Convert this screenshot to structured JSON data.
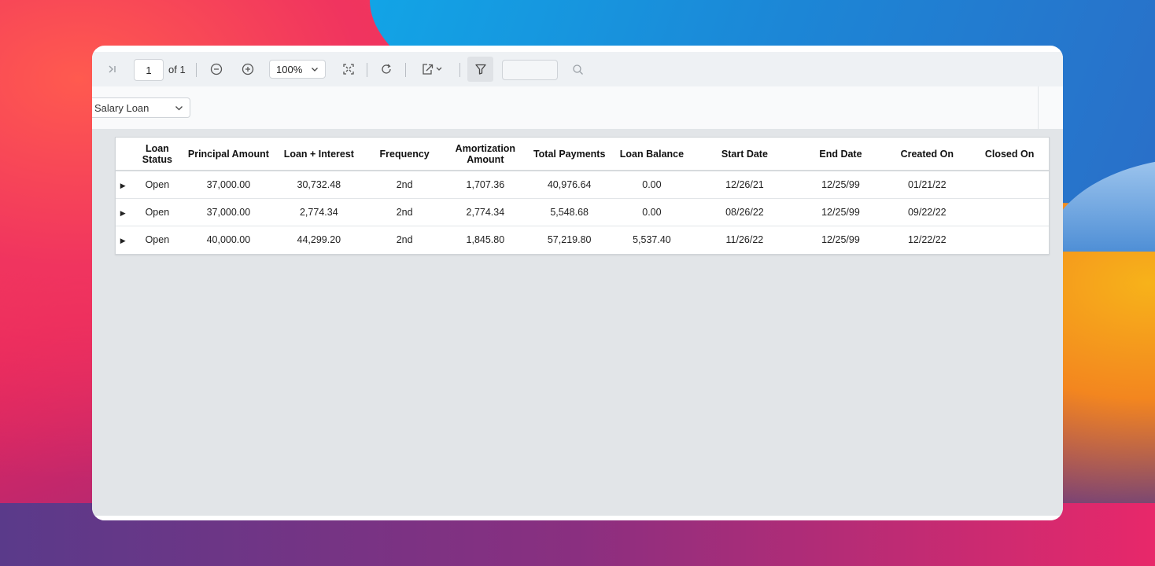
{
  "toolbar": {
    "page_number": "1",
    "page_of": "of 1",
    "zoom_level": "100%",
    "search_placeholder": ""
  },
  "parameters": {
    "loan_type": "Salary Loan"
  },
  "report": {
    "columns": [
      "",
      "Loan Status",
      "Principal Amount",
      "Loan + Interest",
      "Frequency",
      "Amortization Amount",
      "Total Payments",
      "Loan Balance",
      "Start Date",
      "End Date",
      "Created On",
      "Closed On"
    ],
    "rows": [
      [
        "Open",
        "37,000.00",
        "30,732.48",
        "2nd",
        "1,707.36",
        "40,976.64",
        "0.00",
        "12/26/21",
        "12/25/99",
        "01/21/22",
        ""
      ],
      [
        "Open",
        "37,000.00",
        "2,774.34",
        "2nd",
        "2,774.34",
        "5,548.68",
        "0.00",
        "08/26/22",
        "12/25/99",
        "09/22/22",
        ""
      ],
      [
        "Open",
        "40,000.00",
        "44,299.20",
        "2nd",
        "1,845.80",
        "57,219.80",
        "5,537.40",
        "11/26/22",
        "12/25/99",
        "12/22/22",
        ""
      ]
    ]
  },
  "icons": [
    "last-page-icon",
    "zoom-out-icon",
    "zoom-in-icon",
    "fit-page-icon",
    "refresh-icon",
    "export-icon",
    "filter-icon",
    "search-icon",
    "chevron-down-icon",
    "expand-row-icon"
  ]
}
